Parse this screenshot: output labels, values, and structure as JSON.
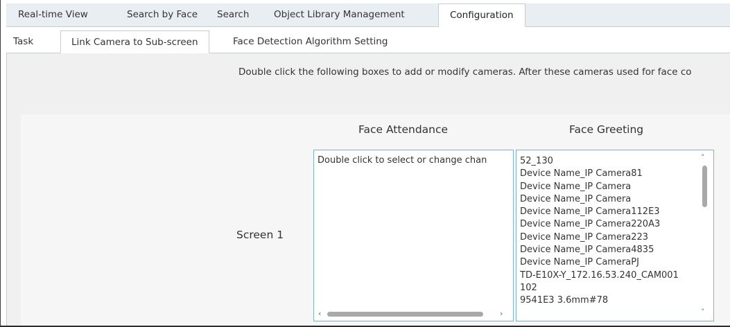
{
  "main_tabs": [
    {
      "label": "Real-time View"
    },
    {
      "label": "Search by Face"
    },
    {
      "label": "Search"
    },
    {
      "label": "Object Library Management"
    },
    {
      "label": "Configuration",
      "active": true
    }
  ],
  "sub_tabs": [
    {
      "label": "Task"
    },
    {
      "label": "Link Camera to Sub-screen",
      "active": true
    },
    {
      "label": "Face Detection Algorithm Setting"
    }
  ],
  "instruction": "Double click the following boxes to add or modify cameras. After these cameras used for face co",
  "columns": {
    "attendance": "Face Attendance",
    "greeting": "Face Greeting"
  },
  "screen": {
    "label": "Screen 1",
    "attendance_placeholder": "Double click to select or change chan",
    "greeting_cameras": [
      "52_130",
      "Device Name_IP Camera81",
      "Device Name_IP Camera",
      "Device Name_IP Camera",
      "Device Name_IP Camera112E3",
      "Device Name_IP Camera220A3",
      "Device Name_IP Camera223",
      "Device Name_IP Camera4835",
      "Device Name_IP CameraPJ",
      "TD-E10X-Y_172.16.53.240_CAM001",
      "102",
      "9541E3 3.6mm#78"
    ]
  },
  "icons": {
    "scroll_left": "‹",
    "scroll_right": "›",
    "scroll_up": "˄",
    "scroll_down": "˅"
  },
  "colors": {
    "box_border": "#7fb2c4",
    "tab_bar_bg": "#e9eef2",
    "content_bg": "#f0f0f0"
  }
}
